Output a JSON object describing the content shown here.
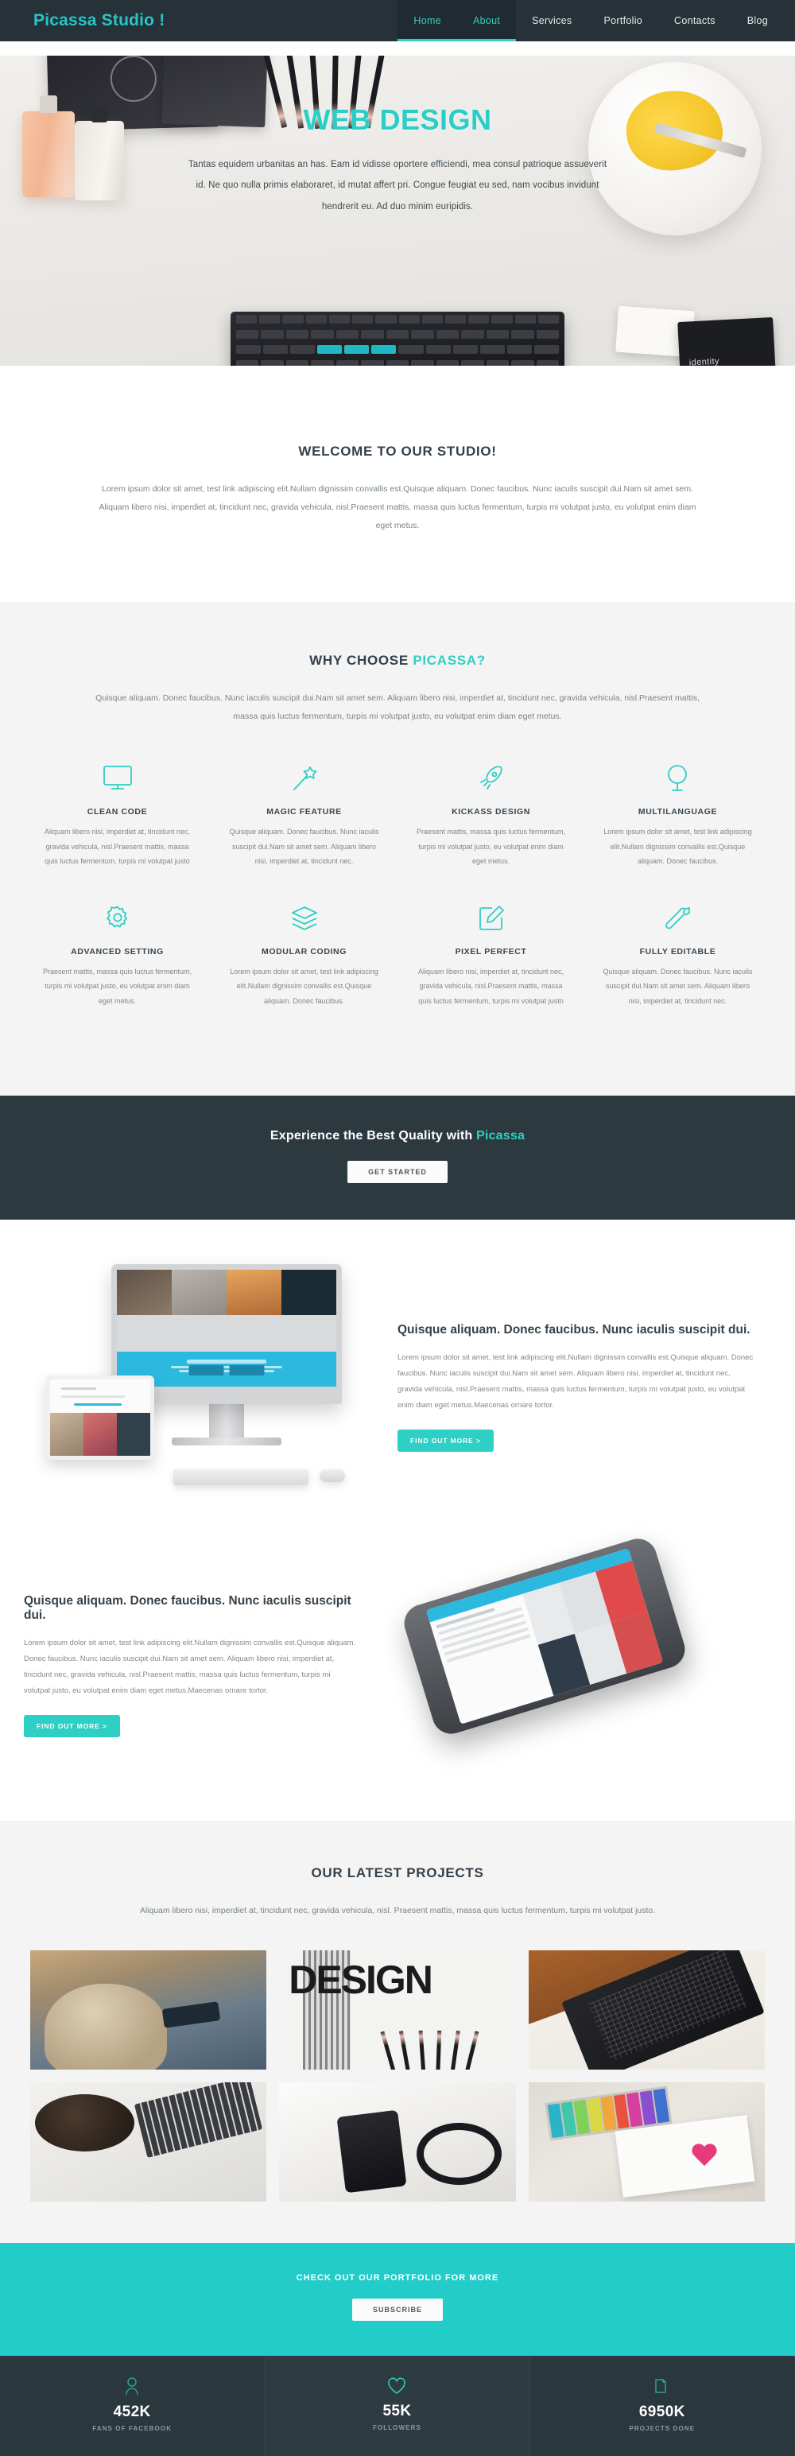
{
  "header": {
    "brand": "Picassa Studio !",
    "nav": [
      {
        "label": "Home",
        "active": true
      },
      {
        "label": "About",
        "active": true
      },
      {
        "label": "Services",
        "active": false
      },
      {
        "label": "Portfolio",
        "active": false
      },
      {
        "label": "Contacts",
        "active": false
      },
      {
        "label": "Blog",
        "active": false
      }
    ]
  },
  "hero": {
    "title": "WEB DESIGN",
    "subtitle": "Tantas equidem urbanitas an has. Eam id vidisse oportere efficiendi, mea consul patrioque assueverit id. Ne quo nulla primis elaboraret, id mutat affert pri. Congue feugiat eu sed, nam vocibus invidunt hendrerit eu. Ad duo minim euripidis.",
    "identity_label": "identity"
  },
  "welcome": {
    "title": "WELCOME TO OUR STUDIO!",
    "body": "Lorem ipsum dolor sit amet, test link adipiscing elit.Nullam dignissim convallis est.Quisque aliquam. Donec faucibus. Nunc iaculis suscipit dui.Nam sit amet sem. Aliquam libero nisi, imperdiet at, tincidunt nec, gravida vehicula, nisl.Praesent mattis, massa quis luctus fermentum, turpis mi volutpat justo, eu volutpat enim diam eget metus."
  },
  "why": {
    "title_plain": "WHY CHOOSE ",
    "title_accent": "PICASSA?",
    "body": "Quisque aliquam. Donec faucibus. Nunc iaculis suscipit dui.Nam sit amet sem. Aliquam libero nisi, imperdiet at, tincidunt nec, gravida vehicula, nisl.Praesent mattis, massa quis luctus fermentum, turpis mi volutpat justo, eu volutpat enim diam eget metus.",
    "features": [
      {
        "icon": "monitor-icon",
        "title": "CLEAN CODE",
        "text": "Aliquam libero nisi, imperdiet at, tincidunt nec, gravida vehicula, nisl.Praesent mattis, massa quis luctus fermentum, turpis mi volutpat justo"
      },
      {
        "icon": "magic-wand-icon",
        "title": "MAGIC FEATURE",
        "text": "Quisque aliquam. Donec faucibus. Nunc iaculis suscipit dui.Nam sit amet sem. Aliquam libero nisi, imperdiet at, tincidunt nec."
      },
      {
        "icon": "rocket-icon",
        "title": "KICKASS DESIGN",
        "text": "Praesent mattis, massa quis luctus fermentum, turpis mi volutpat justo, eu volutpat enim diam eget metus."
      },
      {
        "icon": "globe-icon",
        "title": "MULTILANGUAGE",
        "text": "Lorem ipsum dolor sit amet, test link adipiscing elit.Nullam dignissim convallis est.Quisque aliquam. Donec faucibus."
      },
      {
        "icon": "gear-icon",
        "title": "ADVANCED SETTING",
        "text": "Praesent mattis, massa quis luctus fermentum, turpis mi volutpat justo, eu volutpat enim diam eget metus."
      },
      {
        "icon": "layers-icon",
        "title": "MODULAR CODING",
        "text": "Lorem ipsum dolor sit amet, test link adipiscing elit.Nullam dignissim convallis est.Quisque aliquam. Donec faucibus."
      },
      {
        "icon": "edit-square-icon",
        "title": "PIXEL PERFECT",
        "text": "Aliquam libero nisi, imperdiet at, tincidunt nec, gravida vehicula, nisl.Praesent mattis, massa quis luctus fermentum, turpis mi volutpat justo"
      },
      {
        "icon": "wrench-icon",
        "title": "FULLY EDITABLE",
        "text": "Quisque aliquam. Donec faucibus. Nunc iaculis suscipit dui.Nam sit amet sem. Aliquam libero nisi, imperdiet at, tincidunt nec."
      }
    ]
  },
  "cta_dark": {
    "text_plain": "Experience the Best Quality with ",
    "text_accent": "Picassa",
    "button": "GET STARTED"
  },
  "showcase": {
    "desktop": {
      "title": "Quisque aliquam. Donec faucibus. Nunc iaculis suscipit dui.",
      "body": "Lorem ipsum dolor sit amet, test link adipiscing elit.Nullam dignissim convallis est.Quisque aliquam. Donec faucibus. Nunc iaculis suscipit dui.Nam sit amet sem. Aliquam libero nisi, imperdiet at, tincidunt nec, gravida vehicula, nisl.Praesent mattis, massa quis luctus fermentum, turpis mi volutpat justo, eu volutpat enim diam eget metus.Maecenas ornare tortor.",
      "button": "FIND OUT MORE >"
    },
    "mobile": {
      "title": "Quisque aliquam. Donec faucibus. Nunc iaculis suscipit dui.",
      "body": "Lorem ipsum dolor sit amet, test link adipiscing elit.Nullam dignissim convallis est.Quisque aliquam. Donec faucibus. Nunc iaculis suscipit dui.Nam sit amet sem. Aliquam libero nisi, imperdiet at, tincidunt nec, gravida vehicula, nisl.Praesent mattis, massa quis luctus fermentum, turpis mi volutpat justo, eu volutpat enim diam eget metus.Maecenas ornare tortor.",
      "button": "FIND OUT MORE >"
    }
  },
  "projects": {
    "title": "OUR LATEST PROJECTS",
    "subtitle": "Aliquam libero nisi, imperdiet at, tincidunt nec, gravida vehicula, nisl. Praesent mattis, massa quis luctus fermentum, turpis mi volutpat justo.",
    "items": [
      {
        "name": "woman-photographing-with-phone"
      },
      {
        "name": "design-poster-with-pencils"
      },
      {
        "name": "keyboard-on-open-notebook"
      },
      {
        "name": "coffee-laptop-and-iphone"
      },
      {
        "name": "smartphone-with-headphones"
      },
      {
        "name": "drawing-pink-heart-with-markers"
      }
    ]
  },
  "subscribe": {
    "title": "CHECK OUT OUR PORTFOLIO FOR MORE",
    "button": "SUBSCRIBE"
  },
  "stats": [
    {
      "icon": "user-icon",
      "value": "452K",
      "label": "FANS OF FACEBOOK"
    },
    {
      "icon": "heart-icon",
      "value": "55K",
      "label": "FOLLOWERS"
    },
    {
      "icon": "folder-icon",
      "value": "6950K",
      "label": "PROJECTS DONE"
    }
  ],
  "colors": {
    "accent": "#2ecfc4",
    "accent_bright": "#22ccc9",
    "dark": "#2c3a40",
    "header_dark": "#263238",
    "light_gray": "#f4f4f4"
  }
}
